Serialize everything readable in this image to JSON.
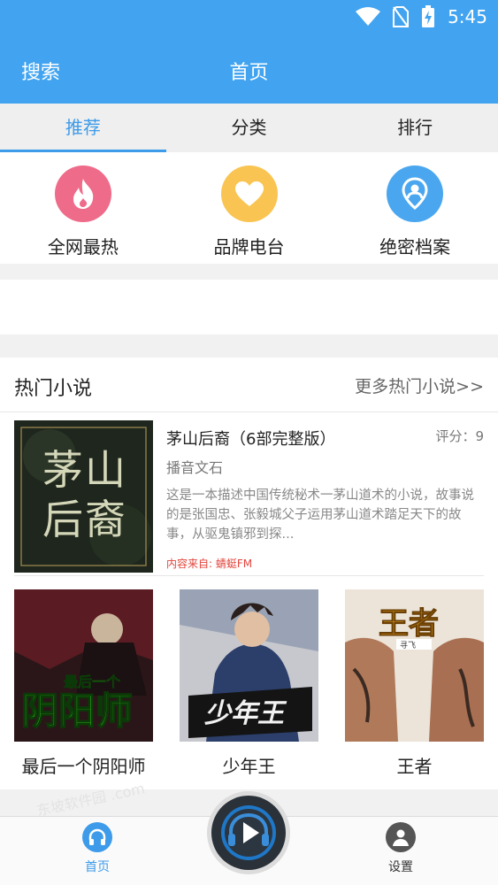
{
  "status_bar": {
    "time": "5:45"
  },
  "header": {
    "search_label": "搜索",
    "title": "首页"
  },
  "tabs": [
    {
      "label": "推荐",
      "active": true
    },
    {
      "label": "分类",
      "active": false
    },
    {
      "label": "排行",
      "active": false
    }
  ],
  "quick_links": [
    {
      "label": "全网最热",
      "icon": "flame-icon",
      "color": "#ef6b8a"
    },
    {
      "label": "品牌电台",
      "icon": "heart-icon",
      "color": "#f9c451"
    },
    {
      "label": "绝密档案",
      "icon": "location-person-icon",
      "color": "#4aa7ef"
    }
  ],
  "hot_novels": {
    "title": "热门小说",
    "more_label": "更多热门小说>>",
    "featured": {
      "title": "茅山后裔（6部完整版）",
      "rating": "评分：9",
      "author": "播音文石",
      "description": "这是一本描述中国传统秘术一茅山道术的小说，故事说的是张国忠、张毅城父子运用茅山道术踏足天下的故事，从驱鬼镇邪到探...",
      "source": "内容来自: 蜻蜓FM",
      "cover_text": "茅山后裔"
    },
    "items": [
      {
        "title": "最后一个阴阳师",
        "cover_text_top": "最后一个",
        "cover_text_main": "阴阳师"
      },
      {
        "title": "少年王",
        "cover_text": "少年王"
      },
      {
        "title": "王者",
        "cover_text": "王者",
        "cover_subtext": "寻飞"
      }
    ]
  },
  "bottom_nav": {
    "home_label": "首页",
    "settings_label": "设置",
    "active_color": "#3d9be9"
  },
  "watermark": "东坡软件园 .com"
}
